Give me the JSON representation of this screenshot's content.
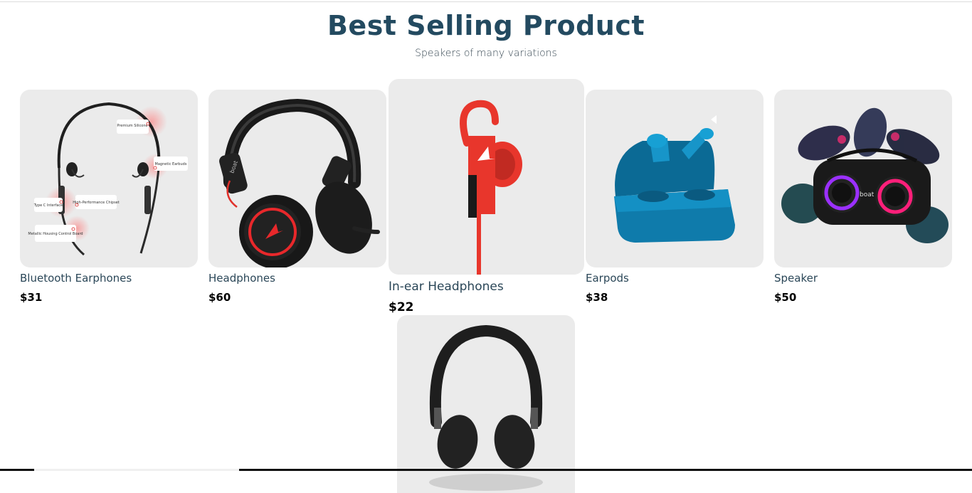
{
  "header": {
    "title": "Best Selling Product",
    "subtitle": "Speakers of many variations"
  },
  "colors": {
    "title": "#234a60",
    "card_background": "#ebebeb",
    "product_name": "#2b4758",
    "price": "#000000"
  },
  "products": [
    {
      "name": "Bluetooth Earphones",
      "price": "$31",
      "icon": "neckband-earphones-image",
      "callouts": [
        "Premium Silicone",
        "Magnetic Earbuds",
        "Type C Interface",
        "High-Performance Chipset",
        "Metallic Housing Control Board"
      ]
    },
    {
      "name": "Headphones",
      "price": "$60",
      "icon": "gaming-headphones-image",
      "brand_mark": "boat"
    },
    {
      "name": "In-ear Headphones",
      "price": "$22",
      "icon": "in-ear-earphone-image"
    },
    {
      "name": "Earpods",
      "price": "$38",
      "icon": "earbuds-case-image"
    },
    {
      "name": "Speaker",
      "price": "$50",
      "icon": "bluetooth-speaker-image",
      "brand_mark": "boat"
    },
    {
      "icon": "wireless-headphones-image"
    }
  ]
}
